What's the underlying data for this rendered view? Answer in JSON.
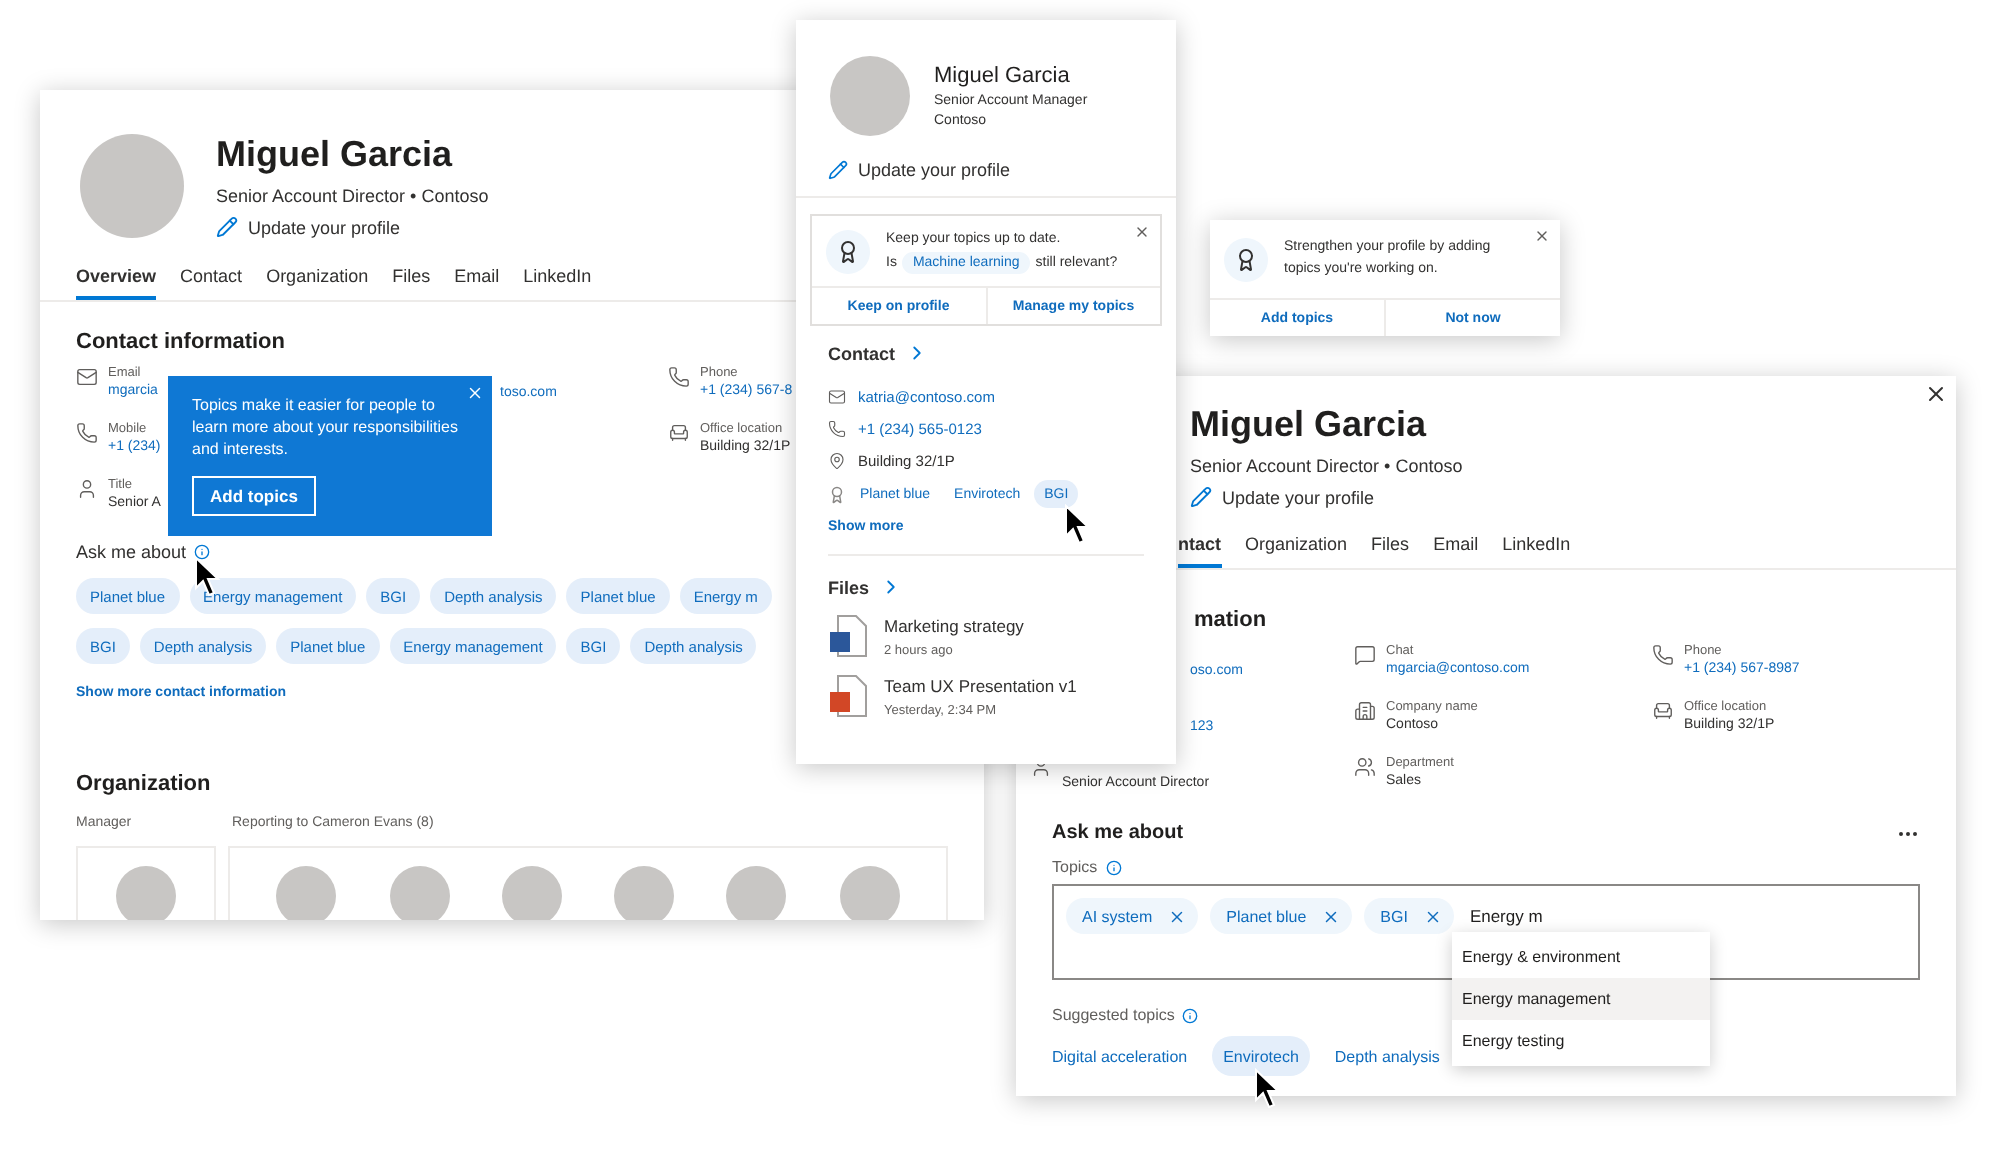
{
  "profile_page": {
    "name": "Miguel Garcia",
    "subtitle": "Senior Account Director • Contoso",
    "update_link": "Update your profile",
    "tabs": [
      {
        "label": "Overview",
        "selected": true
      },
      {
        "label": "Contact",
        "selected": false
      },
      {
        "label": "Organization",
        "selected": false
      },
      {
        "label": "Files",
        "selected": false
      },
      {
        "label": "Email",
        "selected": false
      },
      {
        "label": "LinkedIn",
        "selected": false
      }
    ],
    "contact_heading": "Contact information",
    "contact_columns": [
      [
        {
          "kind": "email",
          "label": "Email",
          "value": "mgarcia",
          "link": true
        },
        {
          "kind": "phone",
          "label": "Mobile",
          "value": "+1 (234)",
          "link": true
        },
        {
          "kind": "title",
          "label": "Title",
          "value": "Senior A",
          "link": false
        }
      ],
      [
        {
          "kind": "hidden",
          "value": "toso.com",
          "link": true
        }
      ],
      [
        {
          "kind": "phone",
          "label": "Phone",
          "value": "+1 (234) 567-8",
          "link": true
        },
        {
          "kind": "office",
          "label": "Office location",
          "value": "Building 32/1P",
          "link": false
        }
      ]
    ],
    "ask_heading": "Ask me about",
    "topic_rows": [
      [
        "Planet blue",
        "Energy management",
        "BGI",
        "Depth analysis",
        "Planet blue",
        "Energy m"
      ],
      [
        "BGI",
        "Depth analysis",
        "Planet blue",
        "Energy management",
        "BGI",
        "Depth analysis"
      ]
    ],
    "show_more": "Show more contact information",
    "org_heading": "Organization",
    "manager_label": "Manager",
    "reports_label": "Reporting to Cameron Evans (8)"
  },
  "callout": {
    "text": "Topics make it easier for people to learn more about your responsibilities and interests.",
    "button": "Add topics"
  },
  "hover_card": {
    "name": "Miguel Garcia",
    "title": "Senior Account Manager",
    "company": "Contoso",
    "update_link": "Update your profile",
    "prompt": {
      "line": "Keep your topics up to date.",
      "before": "Is",
      "topic": "Machine learning",
      "after": "still relevant?",
      "actions": [
        "Keep on profile",
        "Manage my topics"
      ]
    },
    "contact_heading": "Contact",
    "contact": [
      {
        "kind": "email",
        "value": "katria@contoso.com",
        "link": true
      },
      {
        "kind": "phone",
        "value": "+1 (234) 565-0123",
        "link": true
      },
      {
        "kind": "location",
        "value": "Building 32/1P",
        "link": false
      }
    ],
    "topics": [
      {
        "label": "Planet blue",
        "selected": false
      },
      {
        "label": "Envirotech",
        "selected": false
      },
      {
        "label": "BGI",
        "selected": true
      }
    ],
    "show_more": "Show more",
    "files_heading": "Files",
    "files": [
      {
        "kind": "word",
        "name": "Marketing strategy",
        "time": "2 hours ago"
      },
      {
        "kind": "powerpoint",
        "name": "Team UX Presentation v1",
        "time": "Yesterday, 2:34 PM"
      }
    ]
  },
  "toast": {
    "text": "Strengthen your profile by adding topics you're working on.",
    "actions": [
      "Add topics",
      "Not now"
    ]
  },
  "edit_card": {
    "name": "Miguel Garcia",
    "subtitle": "Senior Account Director • Contoso",
    "update_link": "Update your profile",
    "tabs": [
      {
        "label": "ntact",
        "selected": true
      },
      {
        "label": "Organization",
        "selected": false
      },
      {
        "label": "Files",
        "selected": false
      },
      {
        "label": "Email",
        "selected": false
      },
      {
        "label": "LinkedIn",
        "selected": false
      }
    ],
    "contact_heading": "mation",
    "contact_columns": [
      [
        {
          "kind": "hidden",
          "value": "oso.com",
          "link": true
        },
        {
          "kind": "hidden",
          "value": "123",
          "link": true
        },
        {
          "kind": "title",
          "value": "Senior Account Director",
          "link": false
        }
      ],
      [
        {
          "kind": "chat",
          "label": "Chat",
          "value": "mgarcia@contoso.com",
          "link": true
        },
        {
          "kind": "company",
          "label": "Company name",
          "value": "Contoso",
          "link": false
        },
        {
          "kind": "department",
          "label": "Department",
          "value": "Sales",
          "link": false
        }
      ],
      [
        {
          "kind": "phone",
          "label": "Phone",
          "value": "+1 (234) 567-8987",
          "link": true
        },
        {
          "kind": "office",
          "label": "Office location",
          "value": "Building 32/1P",
          "link": false
        }
      ]
    ],
    "ask_heading": "Ask me about",
    "topics_label": "Topics",
    "chosen_topics": [
      "AI system",
      "Planet blue",
      "BGI"
    ],
    "typed": "Energy m",
    "options": [
      {
        "label": "Energy & environment",
        "selected": false
      },
      {
        "label": "Energy management",
        "selected": true
      },
      {
        "label": "Energy testing",
        "selected": false
      }
    ],
    "suggested_label": "Suggested topics",
    "suggested": [
      {
        "label": "Digital acceleration",
        "selected": false
      },
      {
        "label": "Envirotech",
        "selected": true
      },
      {
        "label": "Depth analysis",
        "selected": false
      }
    ]
  }
}
